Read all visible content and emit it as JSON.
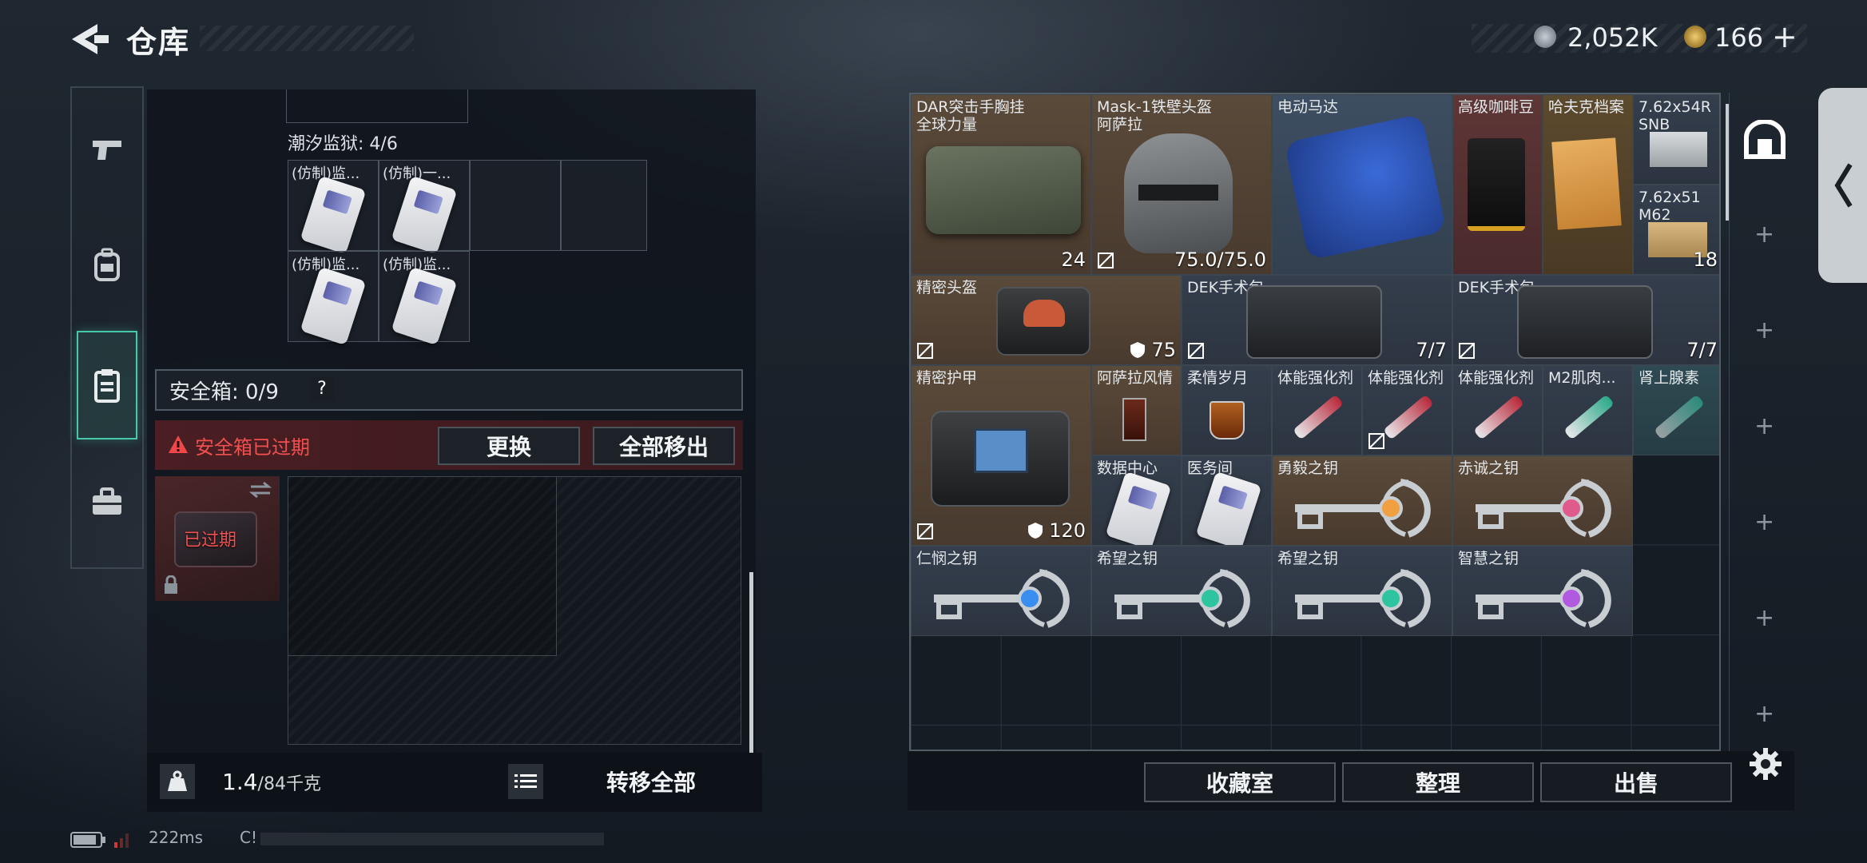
{
  "header": {
    "title": "仓库",
    "currency1": "2,052K",
    "currency2": "166",
    "plus": "+"
  },
  "nav": {
    "items": [
      "pistol",
      "backpack",
      "safe-box",
      "toolbox"
    ],
    "active": "safe-box"
  },
  "left": {
    "tide_prison": {
      "label": "潮汐监狱: 4/6",
      "items": [
        "(仿制)监...",
        "(仿制)一...",
        "(仿制)监...",
        "(仿制)监..."
      ]
    },
    "safebox": {
      "label": "安全箱: 0/9",
      "help": "?",
      "expired_msg": "安全箱已过期",
      "replace": "更换",
      "move_all_out": "全部移出",
      "box_badge": "已过期"
    },
    "weight": {
      "value": "1.4",
      "max": "/84千克"
    },
    "transfer_all": "转移全部"
  },
  "grid": {
    "items": [
      {
        "name": "DAR突击手胸挂\n全球力量",
        "value": "24"
      },
      {
        "name": "Mask-1铁壁头盔\n阿萨拉",
        "value": "75.0/75.0"
      },
      {
        "name": "电动马达",
        "value": ""
      },
      {
        "name": "高级咖啡豆",
        "value": ""
      },
      {
        "name": "哈夫克档案",
        "value": ""
      },
      {
        "name": "7.62x54R\nSNB",
        "value": ""
      },
      {
        "name": "7.62x51\nM62",
        "value": "18"
      },
      {
        "name": "精密头盔",
        "value": "75"
      },
      {
        "name": "DEK手术包",
        "value": "7/7"
      },
      {
        "name": "DEK手术包",
        "value": "7/7"
      },
      {
        "name": "精密护甲",
        "value": "120"
      },
      {
        "name": "阿萨拉风情",
        "value": ""
      },
      {
        "name": "柔情岁月",
        "value": ""
      },
      {
        "name": "体能强化剂",
        "value": ""
      },
      {
        "name": "体能强化剂",
        "value": ""
      },
      {
        "name": "体能强化剂",
        "value": ""
      },
      {
        "name": "M2肌肉...",
        "value": ""
      },
      {
        "name": "肾上腺素",
        "value": ""
      },
      {
        "name": "数据中心",
        "value": ""
      },
      {
        "name": "医务间",
        "value": ""
      },
      {
        "name": "勇毅之钥",
        "value": ""
      },
      {
        "name": "赤诚之钥",
        "value": ""
      },
      {
        "name": "仁悯之钥",
        "value": ""
      },
      {
        "name": "希望之钥",
        "value": ""
      },
      {
        "name": "希望之钥",
        "value": ""
      },
      {
        "name": "智慧之钥",
        "value": ""
      }
    ]
  },
  "bottom": {
    "collection": "收藏室",
    "organize": "整理",
    "sell": "出售"
  },
  "status": {
    "ping": "222ms",
    "extra": "C!"
  },
  "colors": {
    "accent": "#48c9a6",
    "danger": "#e04848",
    "key_gem_gold": "#f0a040",
    "key_gem_pink": "#e05a8c",
    "key_gem_blue": "#3a8ef0",
    "key_gem_green": "#2ec4a0",
    "key_gem_purple": "#b05ae0"
  }
}
